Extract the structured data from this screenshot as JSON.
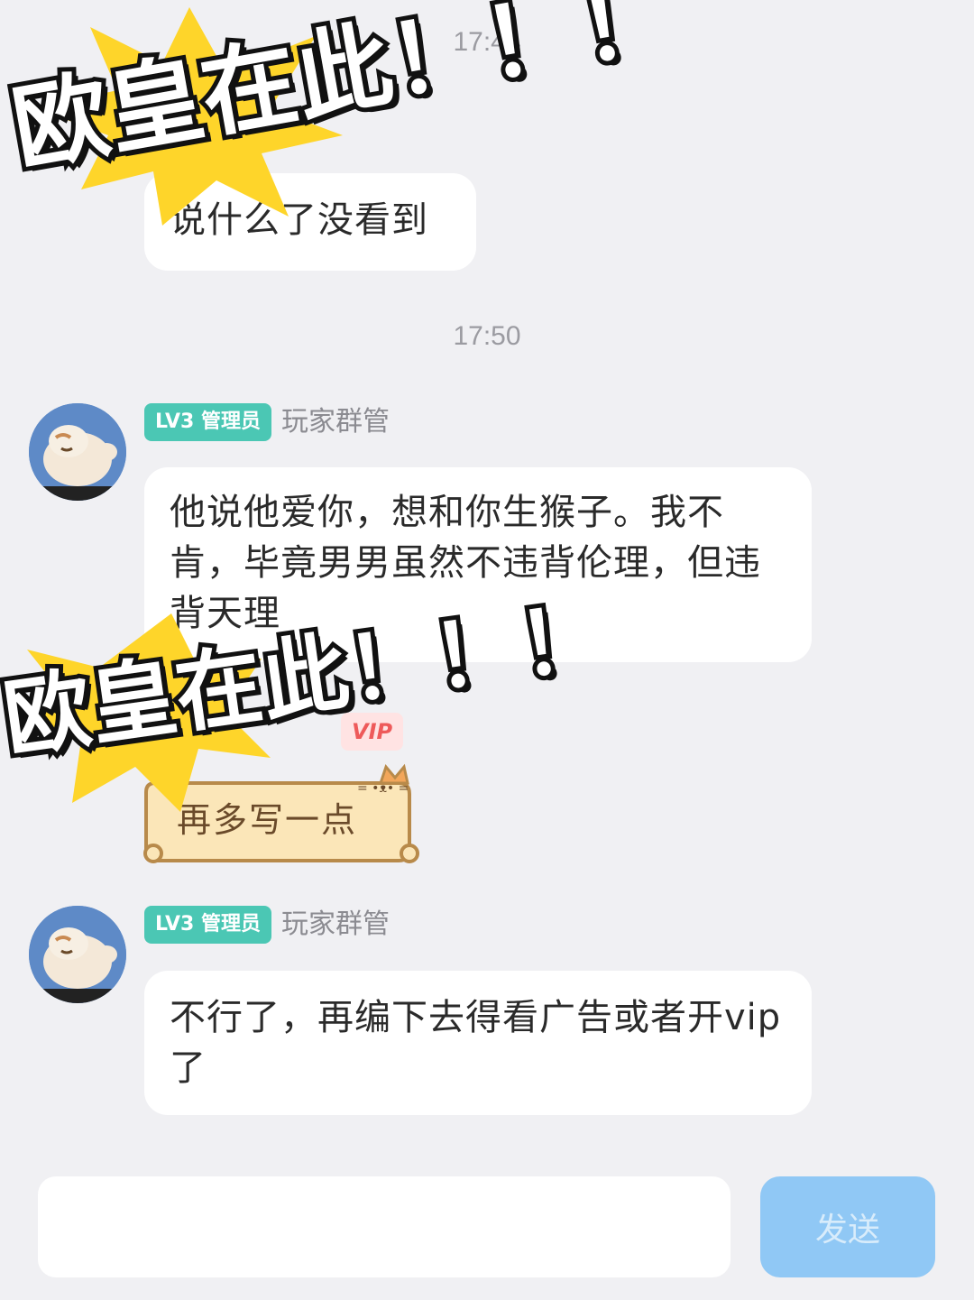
{
  "messages": [
    {
      "text": "说什么了没看到"
    },
    {
      "timestamp": "17:50"
    },
    {
      "badge": "LV3 管理员",
      "sender": "玩家群管",
      "text": "他说他爱你，想和你生猴子。我不肯，毕竟男男虽然不违背伦理，但违背天理"
    },
    {
      "vip_badge": "VIP",
      "text": "再多写一点"
    },
    {
      "badge": "LV3 管理员",
      "sender": "玩家群管",
      "text": "不行了，再编下去得看广告或者开vip了"
    }
  ],
  "top_timestamp": "17:44",
  "stickers": {
    "sticker_1": "欧皇在此！！！",
    "sticker_2": "欧皇在此！！！"
  },
  "input": {
    "value": "",
    "placeholder": "",
    "send_label": "发送"
  },
  "colors": {
    "background": "#f0f0f3",
    "badge": "#4bc7b4",
    "send_button": "#90c8f5",
    "sticker_star": "#fed52a"
  }
}
